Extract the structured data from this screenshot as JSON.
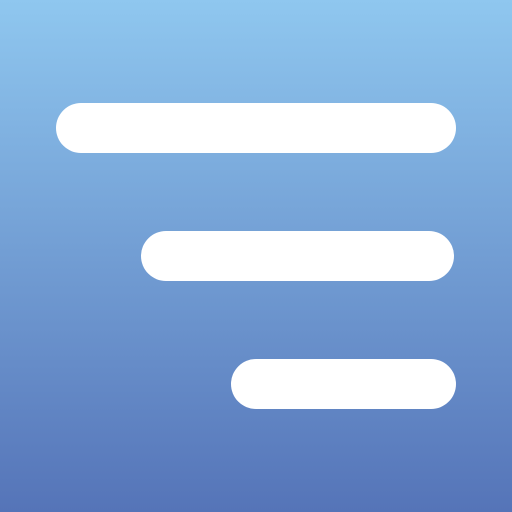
{
  "icon": {
    "name": "filter-lines-icon",
    "colors": {
      "gradient_top": "#8fc7ef",
      "gradient_bottom": "#5574b8",
      "bars": "#ffffff"
    },
    "bars": [
      {
        "name": "long-line"
      },
      {
        "name": "medium-line"
      },
      {
        "name": "short-line"
      }
    ]
  }
}
